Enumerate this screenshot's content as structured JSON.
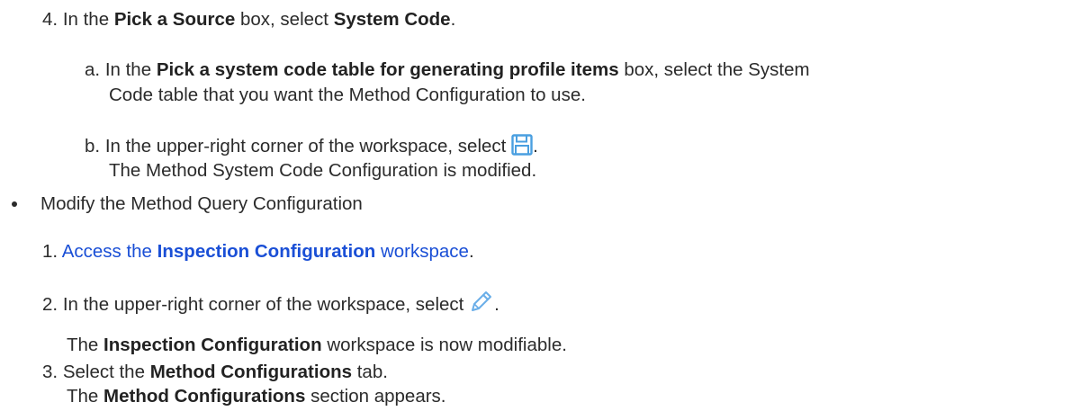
{
  "steps_system_code": {
    "step4": {
      "num": "4.",
      "pre": "In the",
      "box": "Pick a Source",
      "mid": "box, select",
      "value": "System Code",
      "end": "."
    },
    "step_a": {
      "num": "a.",
      "pre": "In the",
      "box": "Pick a system code table for generating profile items",
      "mid": "box, select the System",
      "line2": "Code table that you want the Method Configuration to use."
    },
    "step_b": {
      "num": "b.",
      "text": "In the upper-right corner of the workspace, select",
      "icon": "save-icon",
      "end": ".",
      "result": "The Method System Code Configuration is modified."
    }
  },
  "bullet_item": {
    "text": "Modify the Method Query Configuration"
  },
  "steps_query": {
    "step1": {
      "num": "1.",
      "pre": "Access the",
      "link_bold": "Inspection Configuration",
      "post": "workspace",
      "end": "."
    },
    "step2": {
      "num": "2.",
      "text": "In the upper-right corner of the workspace, select",
      "icon": "pencil-edit-icon",
      "end": ".",
      "result_bold": "Inspection Configuration",
      "result_pre": "The",
      "result_post": "workspace is now modifiable."
    },
    "step3": {
      "num": "3.",
      "pre": "Select the",
      "tab": "Method Configurations",
      "post": "tab.",
      "result_pre": "The",
      "result_bold": "Method Configurations",
      "result_post": "section appears."
    }
  },
  "colors": {
    "text": "#2b2b2b",
    "link": "#1a4fd6",
    "save_icon": "#4a9fe0",
    "pencil_icon": "#6aaee8"
  }
}
